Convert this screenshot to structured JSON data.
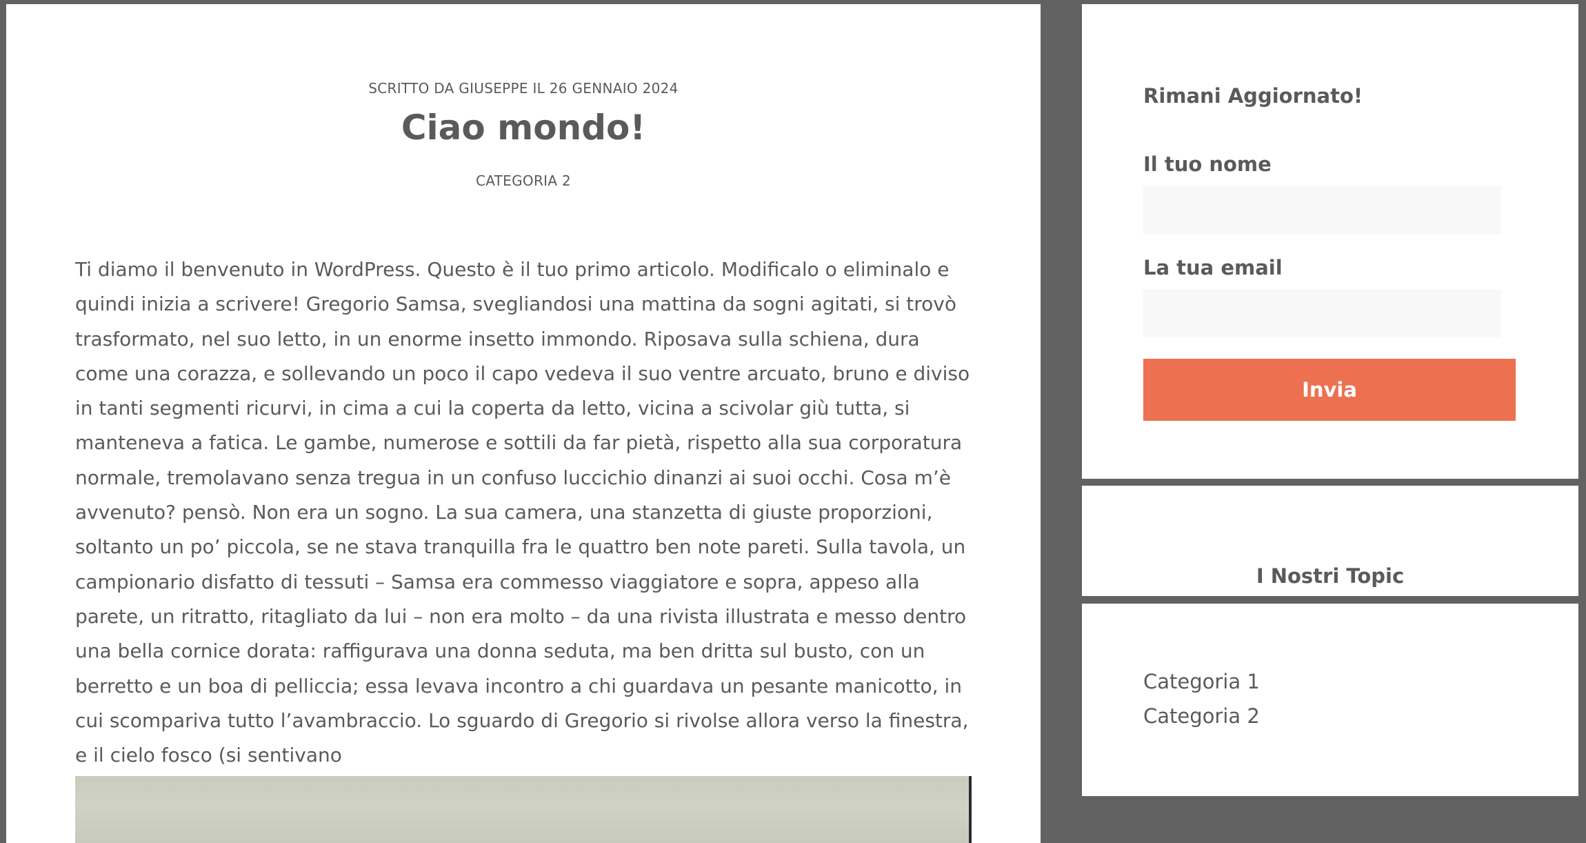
{
  "post": {
    "meta": "SCRITTO DA GIUSEPPE IL 26 GENNAIO 2024",
    "title": "Ciao mondo!",
    "category": "CATEGORIA 2",
    "body": "Ti diamo il benvenuto in WordPress. Questo è il tuo primo articolo. Modificalo o eliminalo e quindi inizia a scrivere! Gregorio Samsa, svegliandosi una mattina da sogni agitati, si trovò trasformato, nel suo letto, in un enorme insetto immondo. Riposava sulla schiena, dura come una corazza, e sollevando un poco il capo vedeva il suo ventre arcuato, bruno e diviso in tanti segmenti ricurvi, in cima a cui la coperta da letto, vicina a scivolar giù tutta, si manteneva a fatica. Le gambe, numerose e sottili da far pietà, rispetto alla sua corporatura normale, tremolavano senza tregua in un confuso luccichio dinanzi ai suoi occhi. Cosa m’è avvenuto? pensò. Non era un sogno. La sua camera, una stanzetta di giuste proporzioni, soltanto un po’ piccola, se ne stava tranquilla fra le quattro ben note pareti. Sulla tavola, un campionario disfatto di tessuti – Samsa era commesso viaggiatore e sopra, appeso alla parete, un ritratto, ritagliato da lui – non era molto – da una rivista illustrata e messo dentro una bella cornice dorata: raffigurava una donna seduta, ma ben dritta sul busto, con un berretto e un boa di pelliccia; essa levava incontro a chi guardava un pesante manicotto, in cui scompariva tutto l’avambraccio. Lo sguardo di Gregorio si rivolse allora verso la finestra, e il cielo fosco (si sentivano"
  },
  "sidebar": {
    "newsletter": {
      "heading": "Rimani Aggiornato!",
      "name_label": "Il tuo nome",
      "name_value": "",
      "email_label": "La tua email",
      "email_value": "",
      "submit_label": "Invia"
    },
    "topics": {
      "title": "I Nostri Topic",
      "items": [
        "Categoria 1",
        "Categoria 2"
      ]
    }
  },
  "colors": {
    "background": "#626262",
    "accent": "#ed7150",
    "text": "#5a5a5a",
    "input_bg": "#f8f8f8"
  }
}
